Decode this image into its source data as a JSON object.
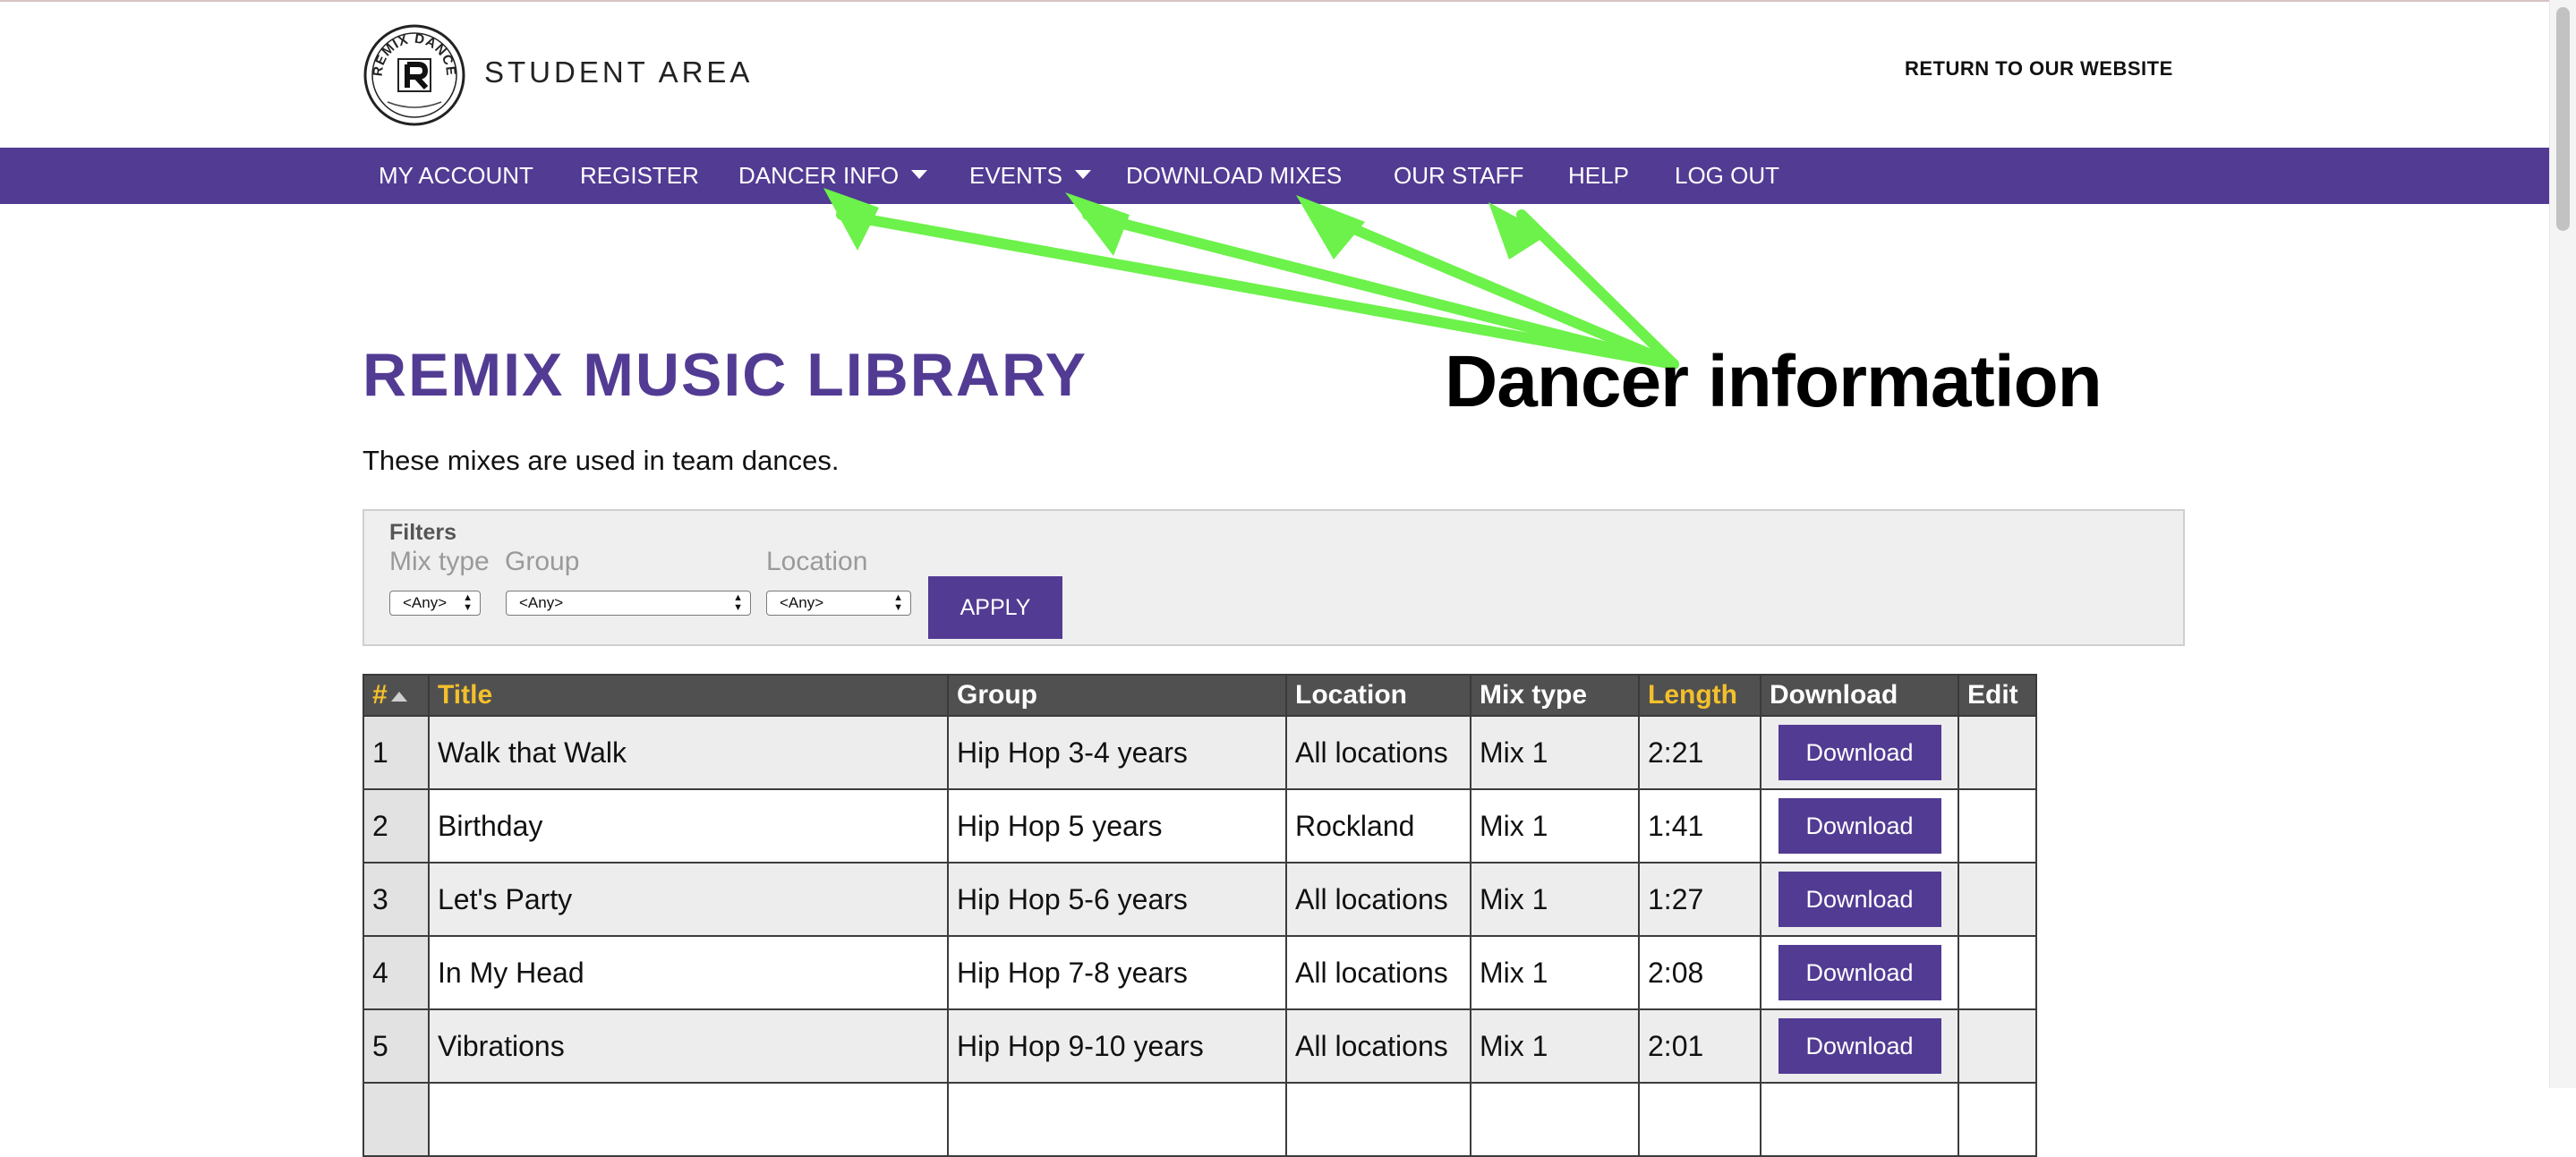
{
  "header": {
    "logo_text": "REMIX DANCE",
    "site_title": "STUDENT AREA",
    "return_link": "RETURN TO OUR WEBSITE"
  },
  "nav": {
    "items": [
      {
        "label": "MY ACCOUNT",
        "has_dropdown": false
      },
      {
        "label": "REGISTER",
        "has_dropdown": false
      },
      {
        "label": "DANCER INFO",
        "has_dropdown": true
      },
      {
        "label": "EVENTS",
        "has_dropdown": true
      },
      {
        "label": "DOWNLOAD MIXES",
        "has_dropdown": false
      },
      {
        "label": "OUR STAFF",
        "has_dropdown": false
      },
      {
        "label": "HELP",
        "has_dropdown": false
      },
      {
        "label": "LOG OUT",
        "has_dropdown": false
      }
    ]
  },
  "annotation": {
    "label": "Dancer information",
    "arrow_color": "#6cf24a"
  },
  "main": {
    "title": "REMIX MUSIC LIBRARY",
    "intro": "These mixes are used in team dances."
  },
  "filters": {
    "title": "Filters",
    "mix_type_label": "Mix type",
    "group_label": "Group",
    "location_label": "Location",
    "mix_type_value": "<Any>",
    "group_value": "<Any>",
    "location_value": "<Any>",
    "apply_label": "APPLY"
  },
  "table": {
    "headers": {
      "num": "#",
      "title": "Title",
      "group": "Group",
      "location": "Location",
      "mix_type": "Mix type",
      "length": "Length",
      "download": "Download",
      "edit": "Edit"
    },
    "download_label": "Download",
    "rows": [
      {
        "num": "1",
        "title": "Walk that Walk",
        "group": "Hip Hop 3-4 years",
        "location": "All locations",
        "mix_type": "Mix 1",
        "length": "2:21"
      },
      {
        "num": "2",
        "title": "Birthday",
        "group": "Hip Hop 5 years",
        "location": "Rockland",
        "mix_type": "Mix 1",
        "length": "1:41"
      },
      {
        "num": "3",
        "title": "Let's Party",
        "group": "Hip Hop 5-6 years",
        "location": "All locations",
        "mix_type": "Mix 1",
        "length": "1:27"
      },
      {
        "num": "4",
        "title": "In My Head",
        "group": "Hip Hop 7-8 years",
        "location": "All locations",
        "mix_type": "Mix 1",
        "length": "2:08"
      },
      {
        "num": "5",
        "title": "Vibrations",
        "group": "Hip Hop 9-10 years",
        "location": "All locations",
        "mix_type": "Mix 1",
        "length": "2:01"
      }
    ]
  },
  "colors": {
    "brand_purple": "#523b93",
    "sort_header": "#f3c02c",
    "table_header": "#505050"
  }
}
